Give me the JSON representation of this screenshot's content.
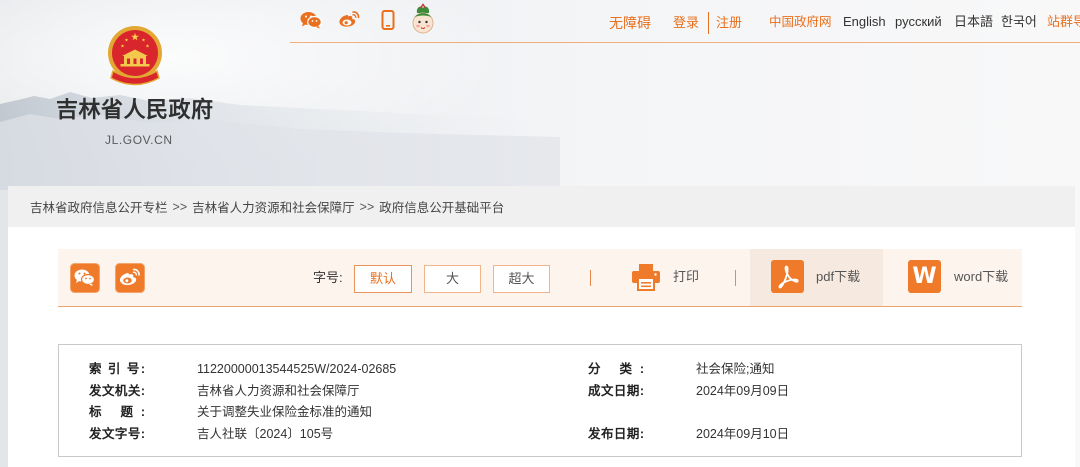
{
  "site": {
    "title": "吉林省人民政府",
    "domain": "JL.GOV.CN",
    "emblem_icon": "national-emblem-icon"
  },
  "topbar": {
    "icons": [
      "wechat-icon",
      "weibo-icon",
      "mobile-icon",
      "mascot-icon"
    ],
    "accessibility": "无障碍",
    "login": "登录",
    "register": "注册",
    "links": [
      {
        "label": "中国政府网"
      },
      {
        "label": "English"
      },
      {
        "label": "русский"
      },
      {
        "label": "日本語"
      },
      {
        "label": "한국어"
      },
      {
        "label": "站群导"
      }
    ]
  },
  "breadcrumb": {
    "items": [
      "吉林省政府信息公开专栏",
      "吉林省人力资源和社会保障厅",
      "政府信息公开基础平台"
    ],
    "separator": ">>"
  },
  "toolbar": {
    "share_icons": [
      "wechat-icon",
      "weibo-icon"
    ],
    "font_size_label": "字号:",
    "font_sizes": [
      "默认",
      "大",
      "超大"
    ],
    "active_font_size_index": 0,
    "print": {
      "icon": "printer-icon",
      "label": "打印"
    },
    "pdf": {
      "icon": "pdf-icon",
      "label": "pdf下载"
    },
    "word": {
      "icon": "word-icon",
      "icon_letter": "W",
      "label": "word下载"
    }
  },
  "info": {
    "index_no": {
      "label": "索 引 号:",
      "value": "11220000013544525W/2024-02685"
    },
    "category": {
      "label": "分 类:",
      "value": "社会保险;通知"
    },
    "issuer": {
      "label": "发文机关:",
      "value": "吉林省人力资源和社会保障厅"
    },
    "written_date": {
      "label": "成文日期:",
      "value": "2024年09月09日"
    },
    "title": {
      "label": "标 题:",
      "value": "关于调整失业保险金标准的通知"
    },
    "doc_no": {
      "label": "发文字号:",
      "value": "吉人社联〔2024〕105号"
    },
    "publish_date": {
      "label": "发布日期:",
      "value": "2024年09月10日"
    }
  },
  "colors": {
    "accent": "#e8701e",
    "toolbar_bg": "#fdf4ed",
    "breadcrumb_bg": "#f0f0f0",
    "emblem_red": "#d9262c",
    "emblem_gold": "#e3a834"
  }
}
